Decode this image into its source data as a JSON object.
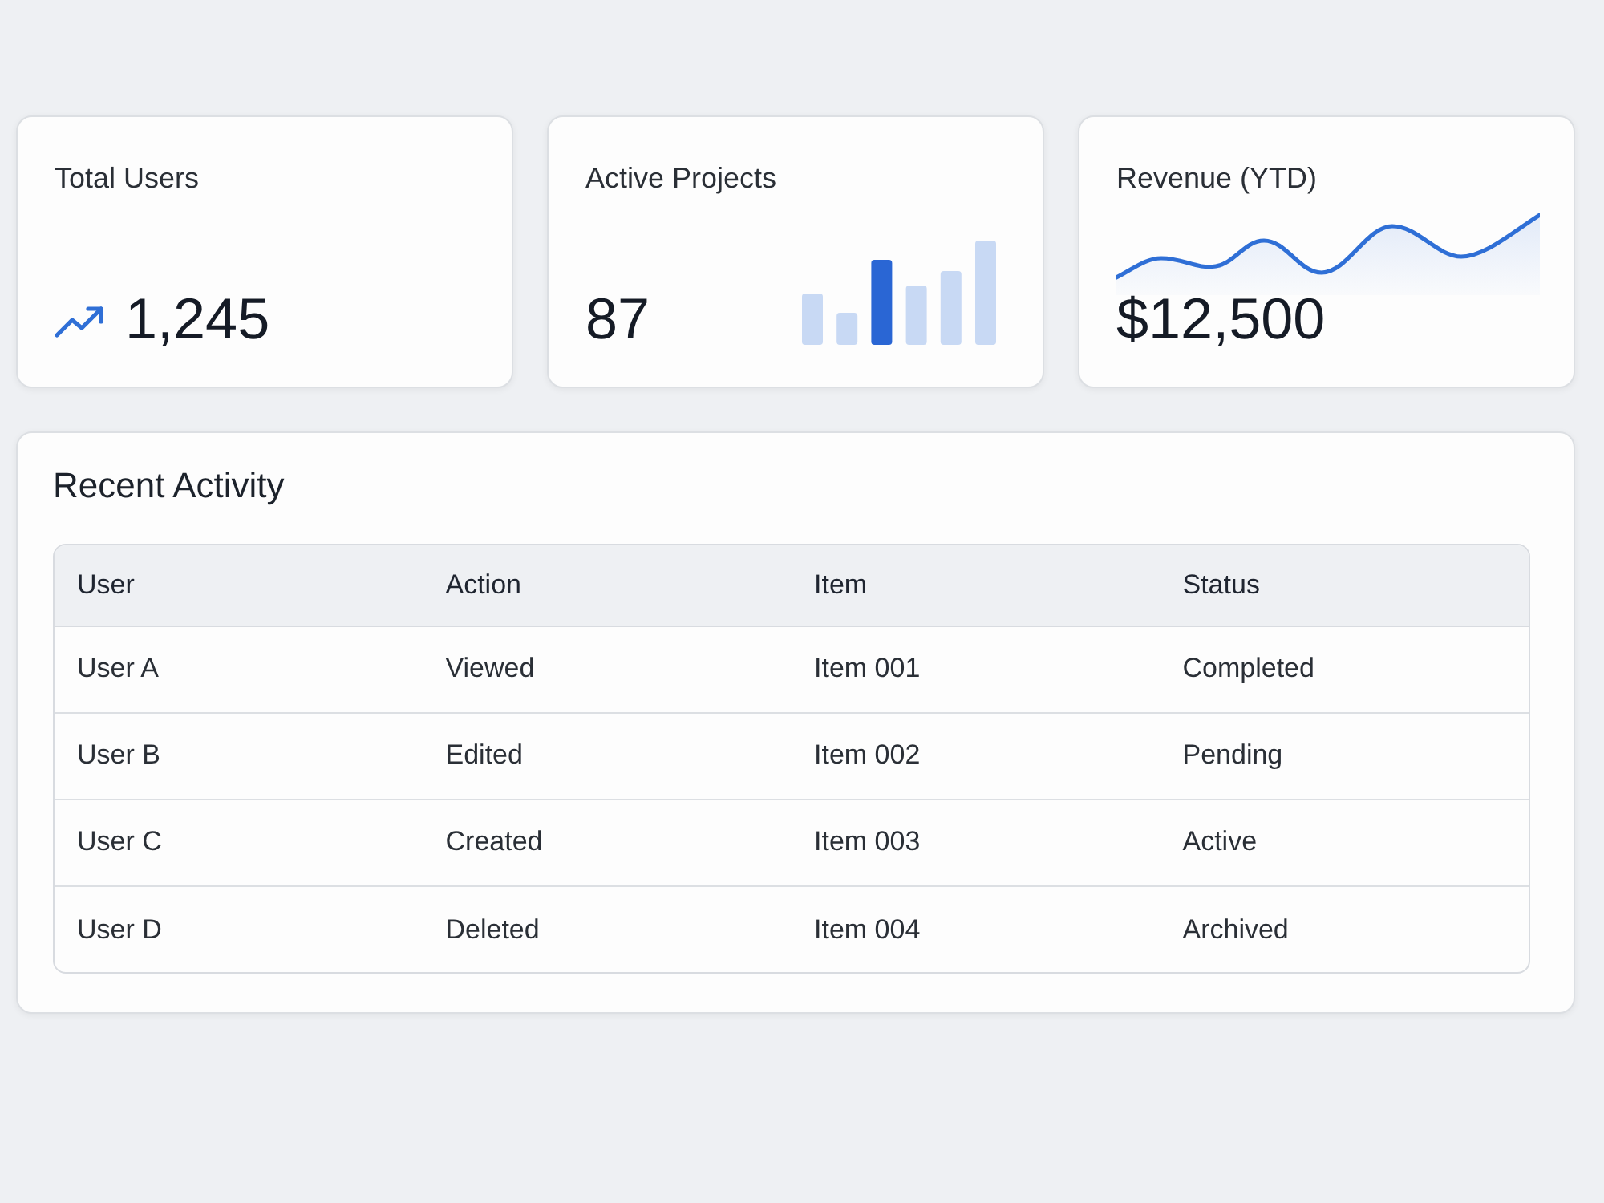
{
  "stat_cards": [
    {
      "kind": "trend",
      "title": "Total Users",
      "value": "1,245"
    },
    {
      "kind": "bars",
      "title": "Active Projects",
      "value": "87"
    },
    {
      "kind": "sparkline",
      "title": "Revenue (YTD)",
      "value": "$12,500"
    }
  ],
  "recent_activity": {
    "title": "Recent Activity",
    "table": {
      "columns": [
        "User",
        "Action",
        "Item",
        "Status"
      ],
      "rows": [
        [
          "User A",
          "Viewed",
          "Item 001",
          "Completed"
        ],
        [
          "User B",
          "Edited",
          "Item 002",
          "Pending"
        ],
        [
          "User C",
          "Created",
          "Item 003",
          "Active"
        ],
        [
          "User D",
          "Deleted",
          "Item 004",
          "Archived"
        ]
      ]
    }
  }
}
